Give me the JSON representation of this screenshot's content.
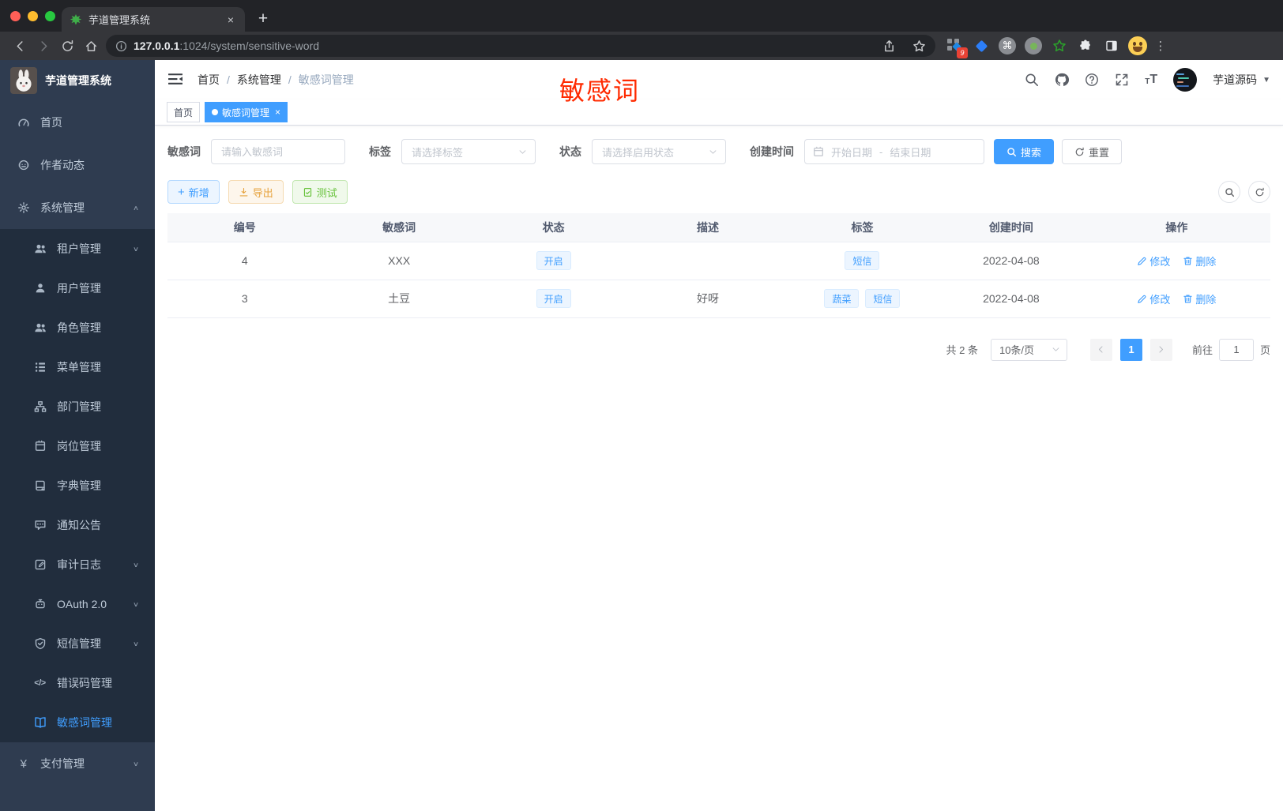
{
  "browser": {
    "tab_title": "芋道管理系统",
    "url_host": "127.0.0.1",
    "url_rest": ":1024/system/sensitive-word",
    "ext_badge": "9"
  },
  "sidebar": {
    "title": "芋道管理系统",
    "items": [
      {
        "label": "首页",
        "icon": "dashboard-icon",
        "type": "top"
      },
      {
        "label": "作者动态",
        "icon": "author-chat-icon",
        "type": "top"
      },
      {
        "label": "系统管理",
        "icon": "gear-icon",
        "type": "top",
        "chevron": "up"
      },
      {
        "label": "租户管理",
        "icon": "users-icon",
        "type": "sub",
        "chevron": "down"
      },
      {
        "label": "用户管理",
        "icon": "user-icon",
        "type": "sub"
      },
      {
        "label": "角色管理",
        "icon": "users-icon",
        "type": "sub"
      },
      {
        "label": "菜单管理",
        "icon": "menu-tree-icon",
        "type": "sub"
      },
      {
        "label": "部门管理",
        "icon": "org-chart-icon",
        "type": "sub"
      },
      {
        "label": "岗位管理",
        "icon": "badge-icon",
        "type": "sub"
      },
      {
        "label": "字典管理",
        "icon": "dict-book-icon",
        "type": "sub"
      },
      {
        "label": "通知公告",
        "icon": "notice-bubble-icon",
        "type": "sub"
      },
      {
        "label": "审计日志",
        "icon": "log-edit-icon",
        "type": "sub",
        "chevron": "down"
      },
      {
        "label": "OAuth 2.0",
        "icon": "robot-icon",
        "type": "sub",
        "chevron": "down"
      },
      {
        "label": "短信管理",
        "icon": "shield-check-icon",
        "type": "sub",
        "chevron": "down"
      },
      {
        "label": "错误码管理",
        "icon": "code-icon",
        "type": "sub"
      },
      {
        "label": "敏感词管理",
        "icon": "open-book-icon",
        "type": "sub",
        "active": true
      },
      {
        "label": "支付管理",
        "icon": "yen-icon",
        "type": "top",
        "chevron": "down"
      }
    ]
  },
  "navbar": {
    "breadcrumb": [
      "首页",
      "系统管理",
      "敏感词管理"
    ],
    "username": "芋道源码"
  },
  "tags_view": [
    {
      "label": "首页",
      "active": false,
      "closable": false
    },
    {
      "label": "敏感词管理",
      "active": true,
      "closable": true
    }
  ],
  "annotation": {
    "text": "敏感词"
  },
  "filters": {
    "keyword_label": "敏感词",
    "keyword_placeholder": "请输入敏感词",
    "tag_label": "标签",
    "tag_placeholder": "请选择标签",
    "status_label": "状态",
    "status_placeholder": "请选择启用状态",
    "date_label": "创建时间",
    "date_start_placeholder": "开始日期",
    "date_separator": "-",
    "date_end_placeholder": "结束日期",
    "search_label": "搜索",
    "reset_label": "重置"
  },
  "toolbar": {
    "add_label": "新增",
    "export_label": "导出",
    "test_label": "测试"
  },
  "table": {
    "columns": [
      "编号",
      "敏感词",
      "状态",
      "描述",
      "标签",
      "创建时间",
      "操作"
    ],
    "rows": [
      {
        "id": "4",
        "word": "XXX",
        "status": "开启",
        "desc": "",
        "tags": [
          "短信"
        ],
        "created": "2022-04-08"
      },
      {
        "id": "3",
        "word": "土豆",
        "status": "开启",
        "desc": "好呀",
        "tags": [
          "蔬菜",
          "短信"
        ],
        "created": "2022-04-08"
      }
    ],
    "edit_label": "修改",
    "delete_label": "删除"
  },
  "pagination": {
    "total": "共 2 条",
    "page_size": "10条/页",
    "current_page": "1",
    "goto_label": "前往",
    "goto_value": "1",
    "page_unit": "页"
  },
  "colors": {
    "accent": "#409eff",
    "sidebar_bg": "#2f3c50",
    "submenu_bg": "#212d3d",
    "annotation_red": "#ff2a00",
    "tab_active_bg": "#409eff"
  }
}
